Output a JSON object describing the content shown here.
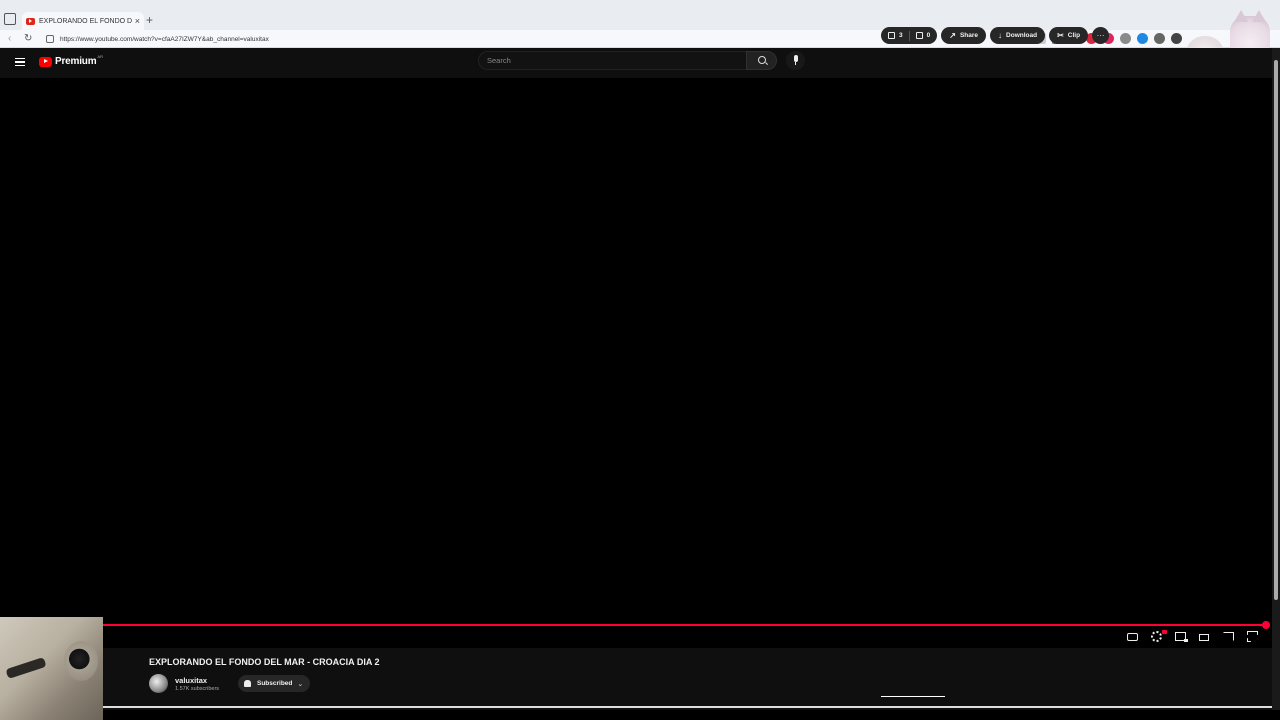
{
  "browser": {
    "tab_title": "EXPLORANDO EL FONDO DEL MAR",
    "tab_close": "×",
    "new_tab": "+",
    "url": "https://www.youtube.com/watch?v=cfaA27IZW7Y&ab_channel=valuxitax"
  },
  "header": {
    "logo_text": "Premium",
    "logo_sup": "AR",
    "search_placeholder": "Search"
  },
  "video": {
    "title": "EXPLORANDO EL FONDO DEL MAR - CROACIA DIA 2",
    "progress_fraction": 1.0
  },
  "channel": {
    "name": "valuxitax",
    "subscribers": "1.57K subscribers",
    "subscribed_label": "Subscribed"
  },
  "actions": {
    "likes": "3",
    "dislikes": "0",
    "share": "Share",
    "download": "Download",
    "clip": "Clip",
    "more": "···"
  },
  "colors": {
    "accent": "#ff0033",
    "header_bg": "#0f0f0f",
    "pill_bg": "#272727"
  }
}
